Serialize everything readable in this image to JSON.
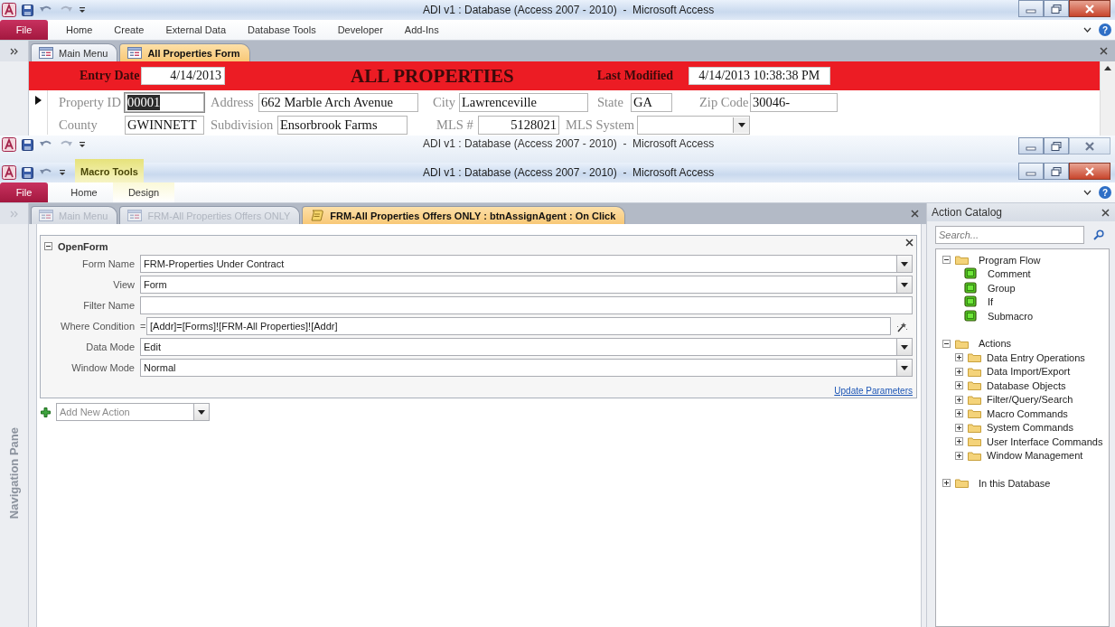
{
  "form_window": {
    "title": "ADI v1 : Database (Access 2007 - 2010)  -  Microsoft Access",
    "active": true,
    "ribbon_tabs": [
      {
        "label": "File",
        "selected": false
      },
      {
        "label": "Home",
        "selected": false
      },
      {
        "label": "Create",
        "selected": false
      },
      {
        "label": "External Data",
        "selected": false
      },
      {
        "label": "Database Tools",
        "selected": false
      },
      {
        "label": "Developer",
        "selected": false
      },
      {
        "label": "Add-Ins",
        "selected": false
      }
    ],
    "help_glyph": "?",
    "document_tabs": [
      {
        "label": "Main Menu",
        "selected": false,
        "faded": false,
        "kind": "form"
      },
      {
        "label": "All Properties Form",
        "selected": true,
        "faded": false,
        "kind": "form"
      }
    ],
    "form": {
      "heading": "ALL PROPERTIES",
      "header_fields": [
        {
          "label": "Entry Date",
          "value": "4/14/2013"
        },
        {
          "label": "Last Modified",
          "value": "4/14/2013 10:38:38 PM"
        }
      ],
      "rows": [
        [
          {
            "label": "Property ID",
            "value": "00001",
            "kind": "text",
            "selected": true
          },
          {
            "label": "Address",
            "value": "662 Marble Arch Avenue",
            "kind": "text",
            "selected": false
          },
          {
            "label": "City",
            "value": "Lawrenceville",
            "kind": "text",
            "selected": false
          },
          {
            "label": "State",
            "value": "GA",
            "kind": "text",
            "selected": false
          },
          {
            "label": "Zip Code",
            "value": "30046-",
            "kind": "text",
            "selected": false
          }
        ],
        [
          {
            "label": "County",
            "value": "GWINNETT",
            "kind": "text",
            "selected": false
          },
          {
            "label": "Subdivision",
            "value": "Ensorbrook Farms",
            "kind": "text",
            "selected": false
          },
          {
            "label": "MLS #",
            "value": "5128021",
            "kind": "number",
            "selected": false
          },
          {
            "label": "MLS System",
            "kind": "combo",
            "selected": false
          }
        ]
      ]
    }
  },
  "middle_window": {
    "title": "ADI v1 : Database (Access 2007 - 2010)  -  Microsoft Access",
    "active": false
  },
  "macro_window": {
    "title": "ADI v1 : Database (Access 2007 - 2010)  -  Microsoft Access",
    "active": true,
    "context_tab": "Macro Tools",
    "ribbon_tabs": [
      {
        "label": "File",
        "selected": false
      },
      {
        "label": "Home",
        "selected": false
      },
      {
        "label": "Design",
        "selected": false
      }
    ],
    "help_glyph": "?",
    "document_tabs": [
      {
        "label": "Main Menu",
        "selected": false,
        "faded": true,
        "kind": "form"
      },
      {
        "label": "FRM-All Properties Offers ONLY",
        "selected": false,
        "faded": true,
        "kind": "form"
      },
      {
        "label": "FRM-All Properties Offers ONLY : btnAssignAgent : On Click",
        "selected": true,
        "faded": false,
        "kind": "macro"
      }
    ],
    "navigation_pane": "Navigation Pane",
    "action": {
      "name": "OpenForm",
      "expanded": true,
      "arguments": [
        {
          "label": "Form Name",
          "value": "FRM-Properties Under Contract",
          "kind": "combo"
        },
        {
          "label": "View",
          "value": "Form",
          "kind": "combo"
        },
        {
          "label": "Filter Name",
          "kind": "text"
        },
        {
          "label": "Where Condition",
          "prefix": "=",
          "value": "[Addr]=[Forms]![FRM-All Properties]![Addr]",
          "kind": "expression"
        },
        {
          "label": "Data Mode",
          "value": "Edit",
          "kind": "combo"
        },
        {
          "label": "Window Mode",
          "value": "Normal",
          "kind": "combo"
        }
      ],
      "link": "Update Parameters"
    },
    "add_action": {
      "placeholder": "Add New Action"
    },
    "action_catalog": {
      "title": "Action Catalog",
      "search": {
        "placeholder": "Search..."
      },
      "tree": [
        {
          "label": "Program Flow",
          "kind": "folder",
          "expanded": true,
          "children": [
            {
              "label": "Comment",
              "kind": "flow"
            },
            {
              "label": "Group",
              "kind": "flow"
            },
            {
              "label": "If",
              "kind": "flow"
            },
            {
              "label": "Submacro",
              "kind": "flow"
            }
          ]
        },
        {
          "label": "Actions",
          "kind": "folder",
          "expanded": true,
          "children": [
            {
              "label": "Data Entry Operations",
              "kind": "folder",
              "expanded": false
            },
            {
              "label": "Data Import/Export",
              "kind": "folder",
              "expanded": false
            },
            {
              "label": "Database Objects",
              "kind": "folder",
              "expanded": false
            },
            {
              "label": "Filter/Query/Search",
              "kind": "folder",
              "expanded": false
            },
            {
              "label": "Macro Commands",
              "kind": "folder",
              "expanded": false
            },
            {
              "label": "System Commands",
              "kind": "folder",
              "expanded": false
            },
            {
              "label": "User Interface Commands",
              "kind": "folder",
              "expanded": false
            },
            {
              "label": "Window Management",
              "kind": "folder",
              "expanded": false
            }
          ]
        },
        {
          "label": "In this Database",
          "kind": "folder",
          "expanded": false
        }
      ]
    }
  }
}
